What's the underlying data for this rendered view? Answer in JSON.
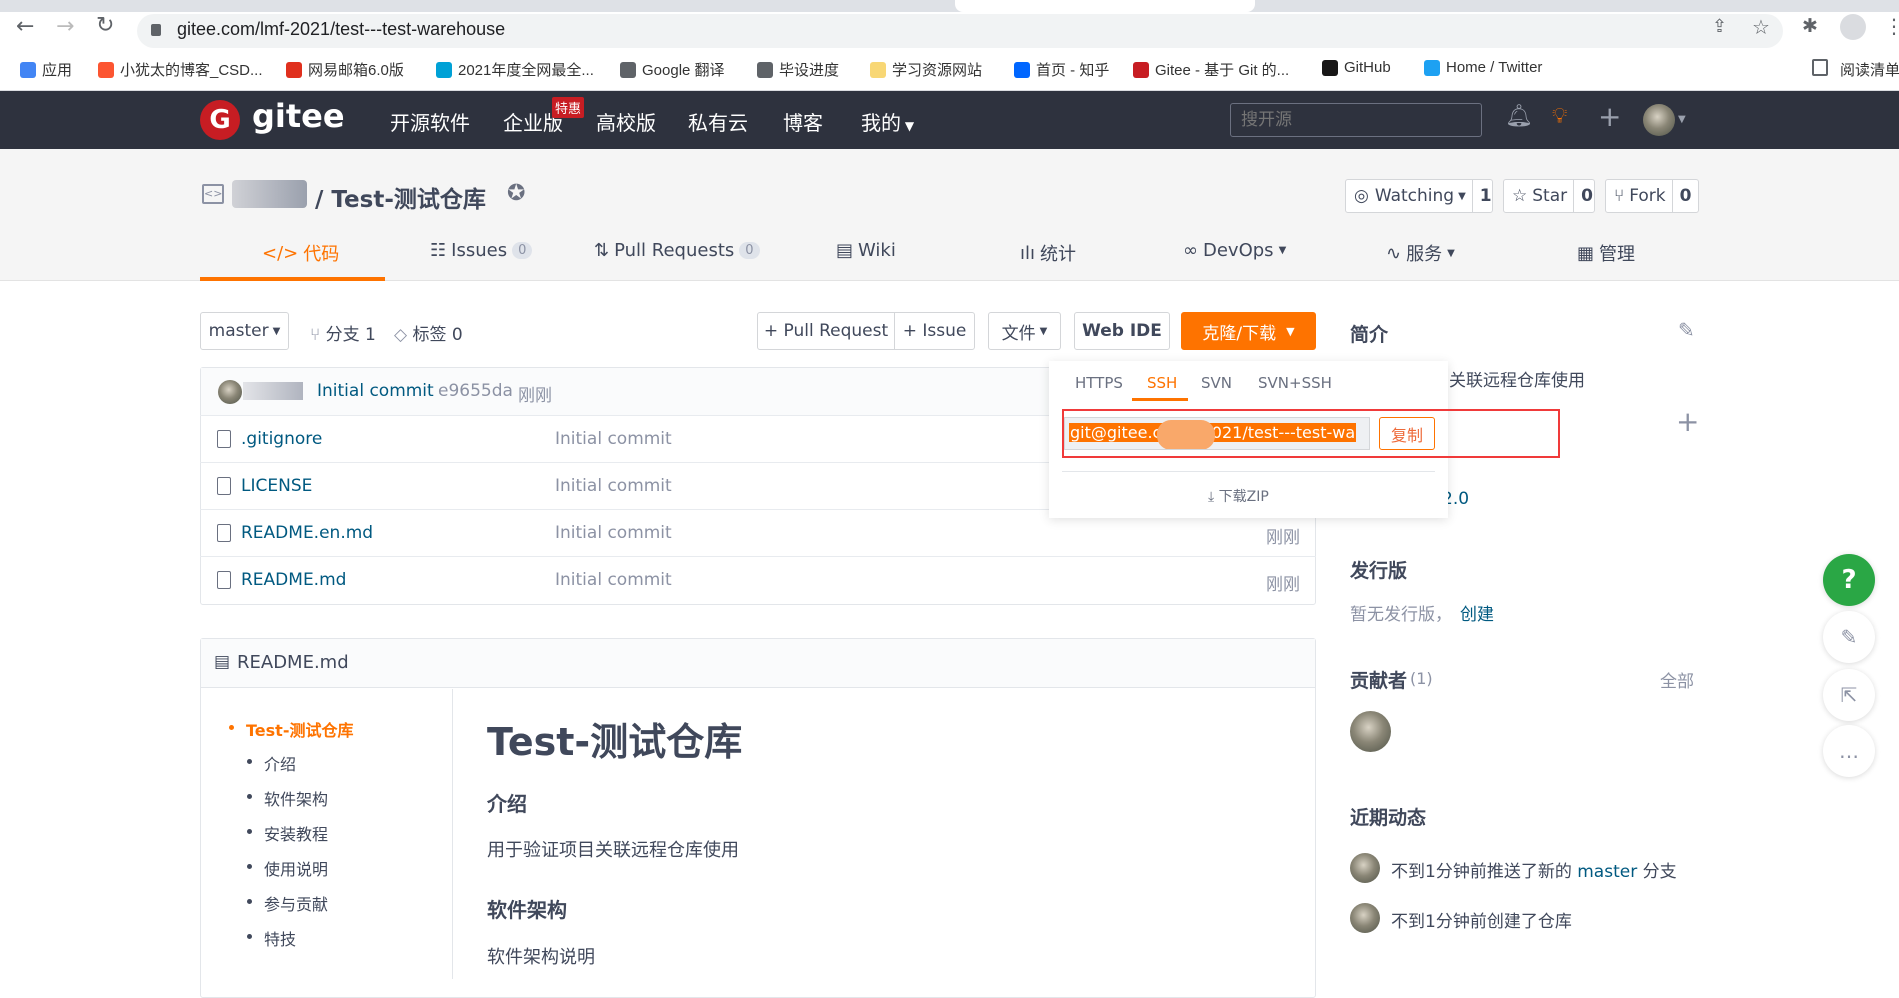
{
  "browser": {
    "url": "gitee.com/lmf-2021/test---test-warehouse",
    "bookmarks": [
      {
        "label": "应用",
        "icon": "apps-grid-icon",
        "color": "#4285f4"
      },
      {
        "label": "小犹太的博客_CSD...",
        "icon": "csdn-icon",
        "color": "#fc5531"
      },
      {
        "label": "网易邮箱6.0版",
        "icon": "netease-mail-icon",
        "color": "#e0301e"
      },
      {
        "label": "2021年度全网最全...",
        "icon": "bilibili-icon",
        "color": "#00a1d6"
      },
      {
        "label": "Google 翻译",
        "icon": "globe-icon",
        "color": "#5f6368"
      },
      {
        "label": "毕设进度",
        "icon": "globe-icon",
        "color": "#5f6368"
      },
      {
        "label": "学习资源网站",
        "icon": "folder-icon",
        "color": "#f8d775"
      },
      {
        "label": "首页 - 知乎",
        "icon": "zhihu-icon",
        "color": "#0066ff"
      },
      {
        "label": "Gitee - 基于 Git 的...",
        "icon": "gitee-icon",
        "color": "#c71d23"
      },
      {
        "label": "GitHub",
        "icon": "github-icon",
        "color": "#181717"
      },
      {
        "label": "Home / Twitter",
        "icon": "twitter-icon",
        "color": "#1da1f2"
      }
    ],
    "reading_list": "阅读清单"
  },
  "header": {
    "logo": "gitee",
    "nav": [
      "开源软件",
      "企业版",
      "高校版",
      "私有云",
      "博客",
      "我的"
    ],
    "promo_badge": "特惠",
    "search_placeholder": "搜开源"
  },
  "repo": {
    "title": "/ Test-测试仓库",
    "watch": {
      "label": "Watching",
      "count": "1"
    },
    "star": {
      "label": "Star",
      "count": "0"
    },
    "fork": {
      "label": "Fork",
      "count": "0"
    },
    "tabs": [
      {
        "label": "代码"
      },
      {
        "label": "Issues",
        "count": "0"
      },
      {
        "label": "Pull Requests",
        "count": "0"
      },
      {
        "label": "Wiki"
      },
      {
        "label": "统计"
      },
      {
        "label": "DevOps"
      },
      {
        "label": "服务"
      },
      {
        "label": "管理"
      }
    ]
  },
  "toolbar": {
    "branch": "master",
    "branches": "分支 1",
    "tags": "标签 0",
    "pull_request": "+ Pull Request",
    "issue": "+ Issue",
    "file": "文件",
    "web_ide": "Web IDE",
    "clone": "克隆/下载"
  },
  "commit": {
    "message": "Initial commit",
    "hash": "e9655da",
    "time": "刚刚"
  },
  "files": [
    {
      "name": ".gitignore",
      "message": "Initial commit",
      "time": ""
    },
    {
      "name": "LICENSE",
      "message": "Initial commit",
      "time": ""
    },
    {
      "name": "README.en.md",
      "message": "Initial commit",
      "time": "刚刚"
    },
    {
      "name": "README.md",
      "message": "Initial commit",
      "time": "刚刚"
    }
  ],
  "clone_popup": {
    "tabs": [
      "HTTPS",
      "SSH",
      "SVN",
      "SVN+SSH"
    ],
    "active": "SSH",
    "url": "git@gitee.co        021/test---test-wa",
    "copy": "复制",
    "download_zip": "下载ZIP"
  },
  "sidebar": {
    "intro_title": "简介",
    "intro_text": "用于验证项目关联远程仓库使用",
    "license_partial": "2.0",
    "releases_title": "发行版",
    "releases_text": "暂无发行版，",
    "releases_create": "创建",
    "contributors_title": "贡献者",
    "contributors_count": "(1)",
    "contributors_all": "全部",
    "activity_title": "近期动态",
    "activity": [
      {
        "pre": "不到1分钟前推送了新的 ",
        "link": "master",
        "post": " 分支"
      },
      {
        "pre": "不到1分钟前创建了仓库",
        "link": "",
        "post": ""
      }
    ]
  },
  "readme": {
    "filename": "README.md",
    "toc": [
      "Test-测试仓库",
      "介绍",
      "软件架构",
      "安装教程",
      "使用说明",
      "参与贡献",
      "特技"
    ],
    "h1": "Test-测试仓库",
    "h2_intro": "介绍",
    "intro": "用于验证项目关联远程仓库使用",
    "h2_arch": "软件架构",
    "arch": "软件架构说明"
  },
  "colors": {
    "accent": "#fe7300",
    "link": "#005980",
    "header": "#2e323e",
    "help": "#2aa745",
    "highlight": "#f03a3a"
  }
}
